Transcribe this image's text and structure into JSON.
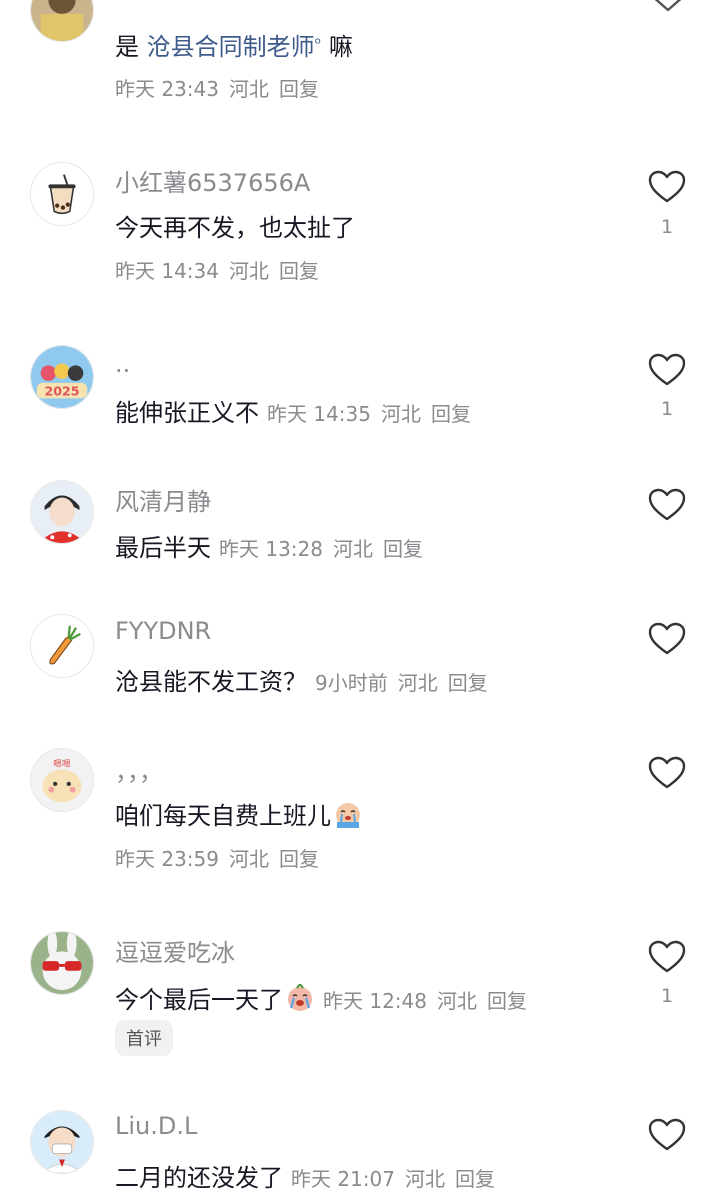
{
  "comments": [
    {
      "name": "",
      "text_prefix": "是 ",
      "link": "沧县合同制老师",
      "link_icon": "ᵒ",
      "text_suffix": " 嘛",
      "time": "昨天 23:43",
      "location": "河北",
      "reply": "回复",
      "likes": ""
    },
    {
      "name": "小红薯6537656A",
      "text": "今天再不发，也太扯了",
      "time": "昨天 14:34",
      "location": "河北",
      "reply": "回复",
      "likes": "1",
      "avatar_icon": "bubble-tea-icon"
    },
    {
      "name": "..",
      "text": "能伸张正义不",
      "time": "昨天 14:35",
      "location": "河北",
      "reply": "回复",
      "likes": "1",
      "avatar_label": "2025"
    },
    {
      "name": "风清月静",
      "text": "最后半天",
      "time": "昨天 13:28",
      "location": "河北",
      "reply": "回复",
      "likes": ""
    },
    {
      "name": "FYYDNR",
      "text": "沧县能不发工资？",
      "time": "9小时前",
      "location": "河北",
      "reply": "回复",
      "likes": "",
      "avatar_icon": "carrot-icon"
    },
    {
      "name": "，，，",
      "text": "咱们每天自费上班儿",
      "emoji": "crying-emoji",
      "time": "昨天 23:59",
      "location": "河北",
      "reply": "回复",
      "likes": "",
      "avatar_label": "嗯嗯"
    },
    {
      "name": "逗逗爱吃冰",
      "text": "今个最后一天了",
      "emoji": "crying-emoji",
      "time": "昨天 12:48",
      "location": "河北",
      "reply": "回复",
      "likes": "1",
      "badge": "首评"
    },
    {
      "name": "Liu.D.L",
      "text": "二月的还没发了",
      "time": "昨天 21:07",
      "location": "河北",
      "reply": "回复",
      "likes": ""
    }
  ],
  "colors": {
    "name": "#8a8a8f",
    "text": "#161823",
    "link": "#3e5a8a",
    "background": "#ffffff"
  }
}
